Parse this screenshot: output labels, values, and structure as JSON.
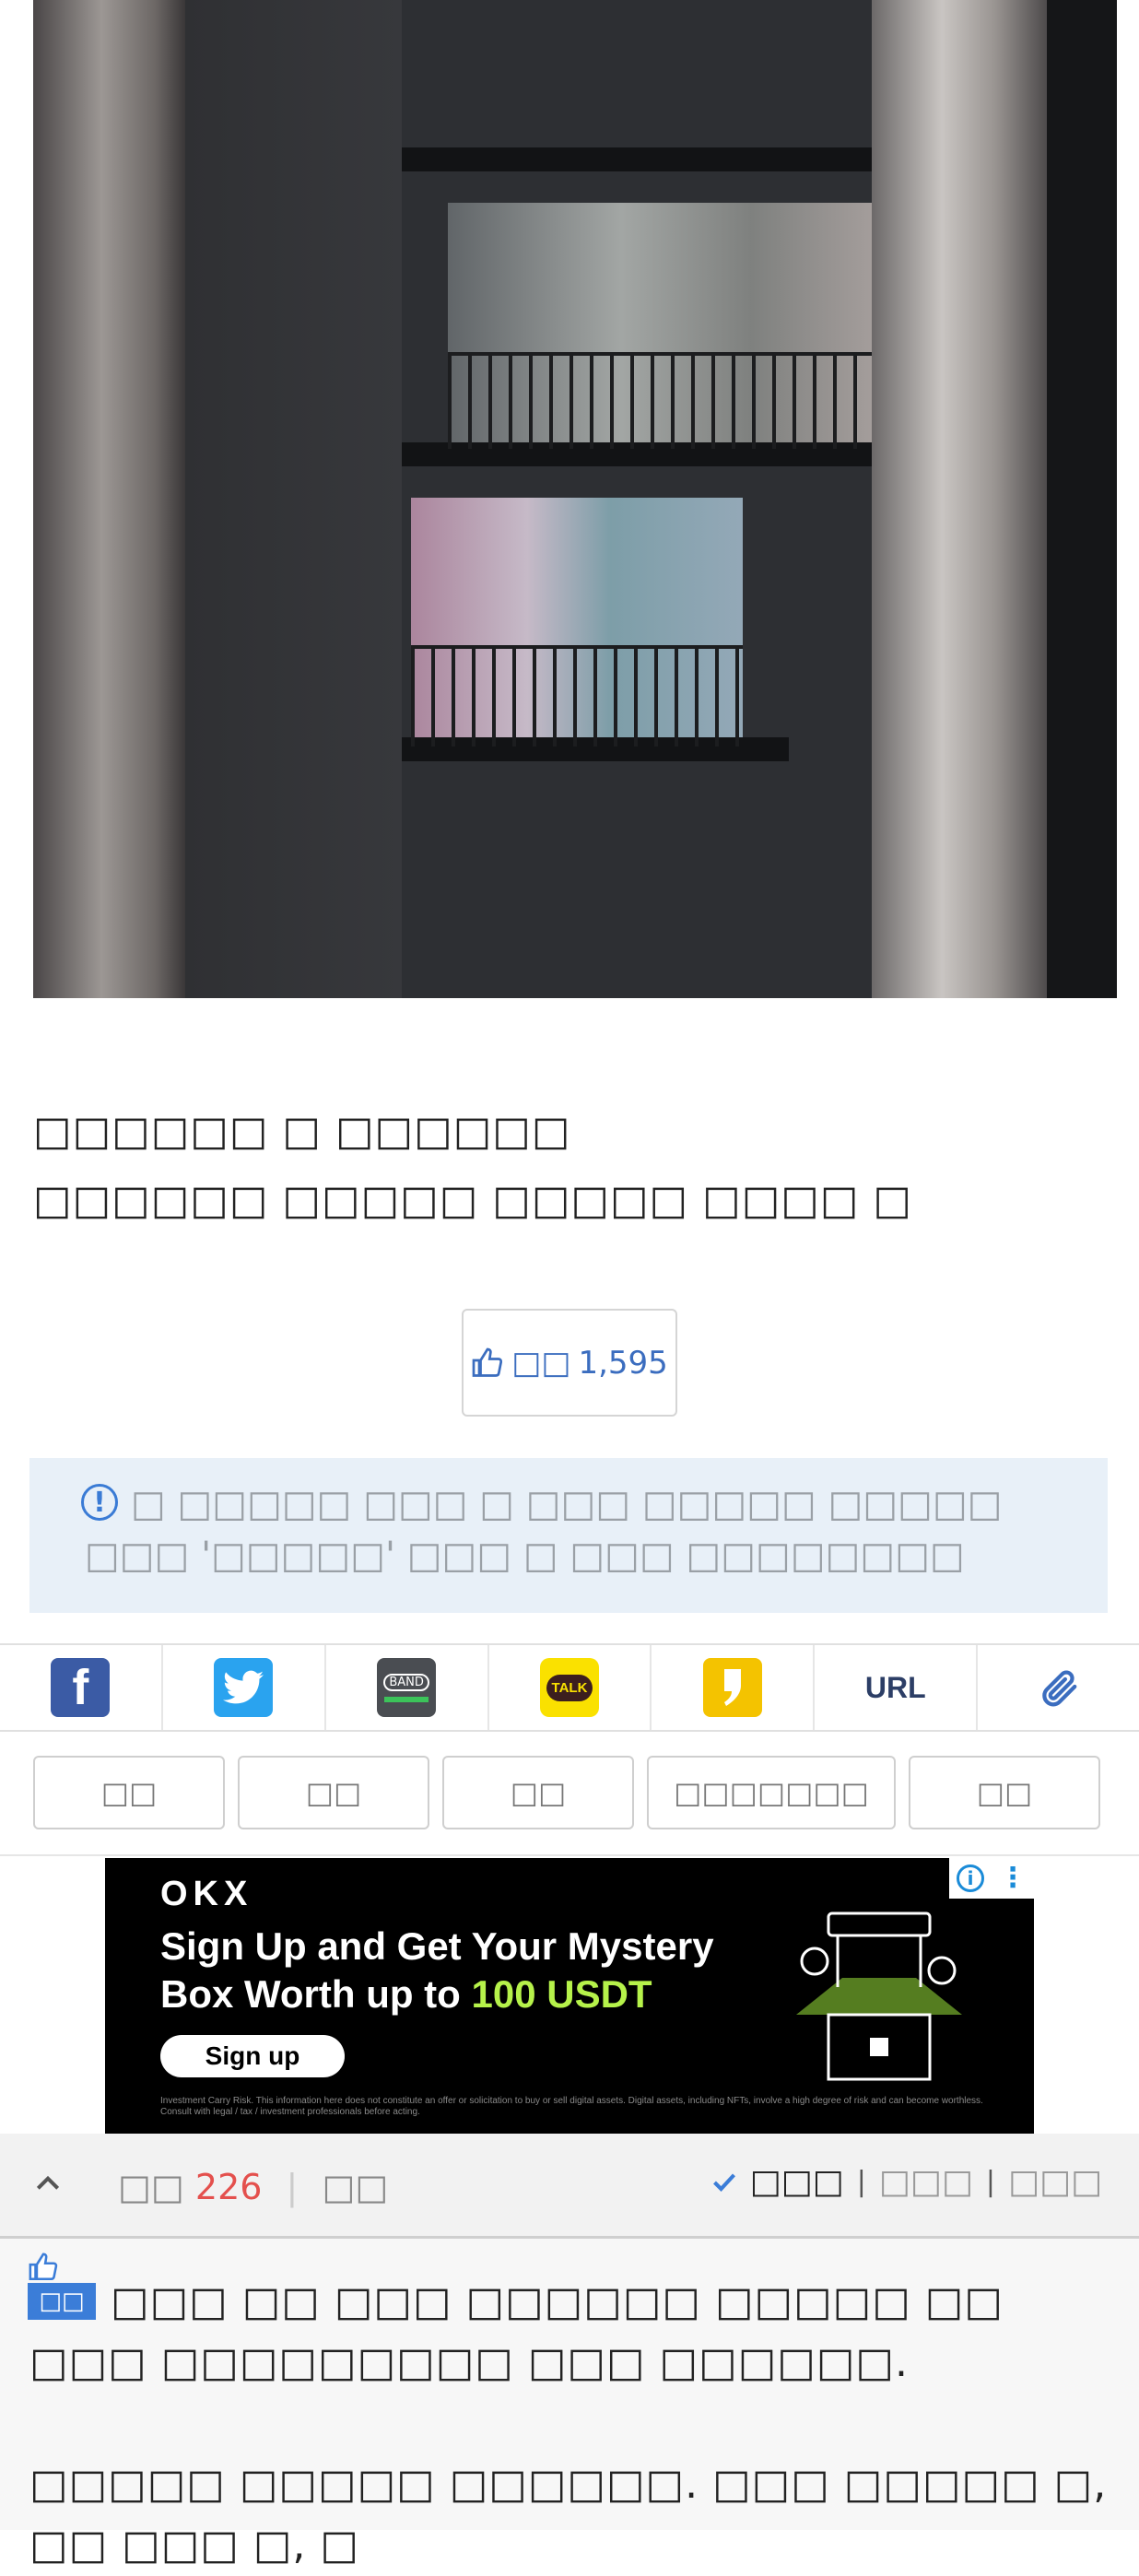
{
  "article": {
    "lines": [
      "□□□□□□ □ □□□□□□",
      "□□□□□□ □□□□□ □□□□□ □□□□ □"
    ]
  },
  "like": {
    "label": "□□",
    "count": "1,595"
  },
  "notice": {
    "text": "□ □□□□□ □□□ □ □□□ □□□□□ □□□□□ □□□ '□□□□□' □□□ □ □□□ □□□□□□□□"
  },
  "share": {
    "band": "BAND",
    "talk": "TALK",
    "url": "URL"
  },
  "actions": [
    "□□",
    "□□",
    "□□",
    "□□□□□□□",
    "□□"
  ],
  "ad": {
    "logo": "OKX",
    "headline_1": "Sign Up and Get Your Mystery",
    "headline_2_pre": "Box Worth up to ",
    "headline_2_hl": "100 USDT",
    "cta": "Sign up",
    "fine": "Investment Carry Risk. This information here does not constitute an offer or solicitation to buy or sell digital assets. Digital assets, including NFTs, involve a high degree of risk and can become worthless. Consult with legal / tax / investment professionals before acting.",
    "accent": "#b6f24a"
  },
  "comments_bar": {
    "label": "□□",
    "count": "226",
    "refresh": "□□",
    "sort": [
      "□□□",
      "□□□",
      "□□□"
    ]
  },
  "comment": {
    "badge": "□□",
    "line1": "□□□ □□ □□□ □□□□□□ □□□□□ □□",
    "line2": "□□□ □□□□□□□□□ □□□ □□□□□□.",
    "line3": "□□□□□ □□□□□ □□□□□□. □□□ □□□□□ □, □□ □□□ □, □"
  }
}
